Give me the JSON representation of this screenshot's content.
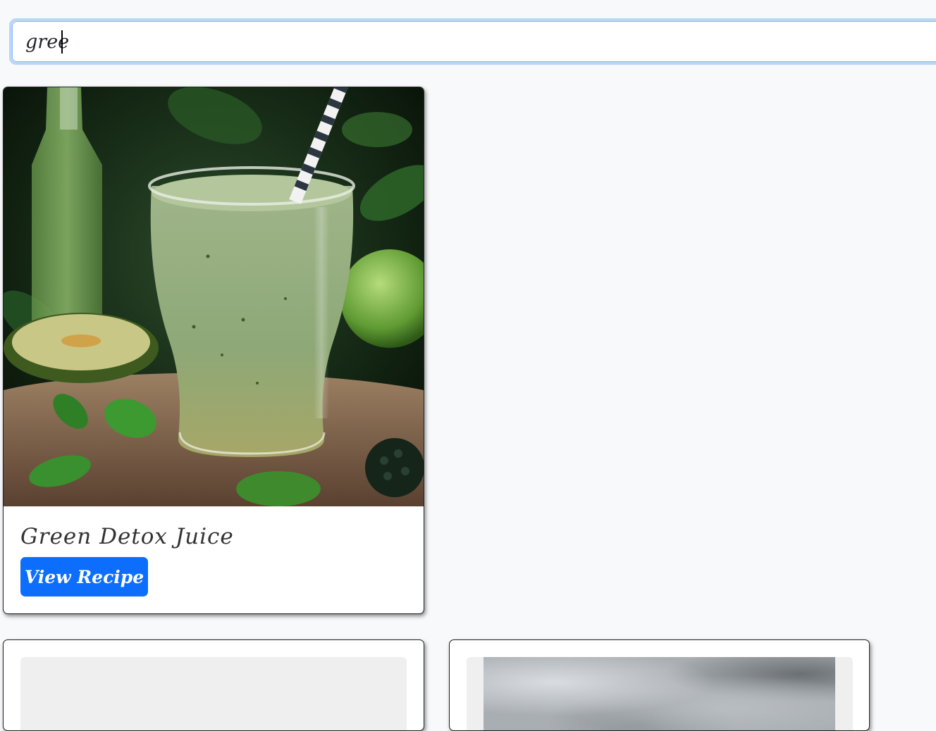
{
  "search": {
    "value": "gree",
    "placeholder": ""
  },
  "results": [
    {
      "title": "Green Detox Juice",
      "button_label": "View Recipe",
      "image": "green-smoothie-photo"
    }
  ],
  "colors": {
    "page_background": "#f8f9fa",
    "button": "#0d6efd",
    "search_focus_ring": "#bcd4f8"
  }
}
